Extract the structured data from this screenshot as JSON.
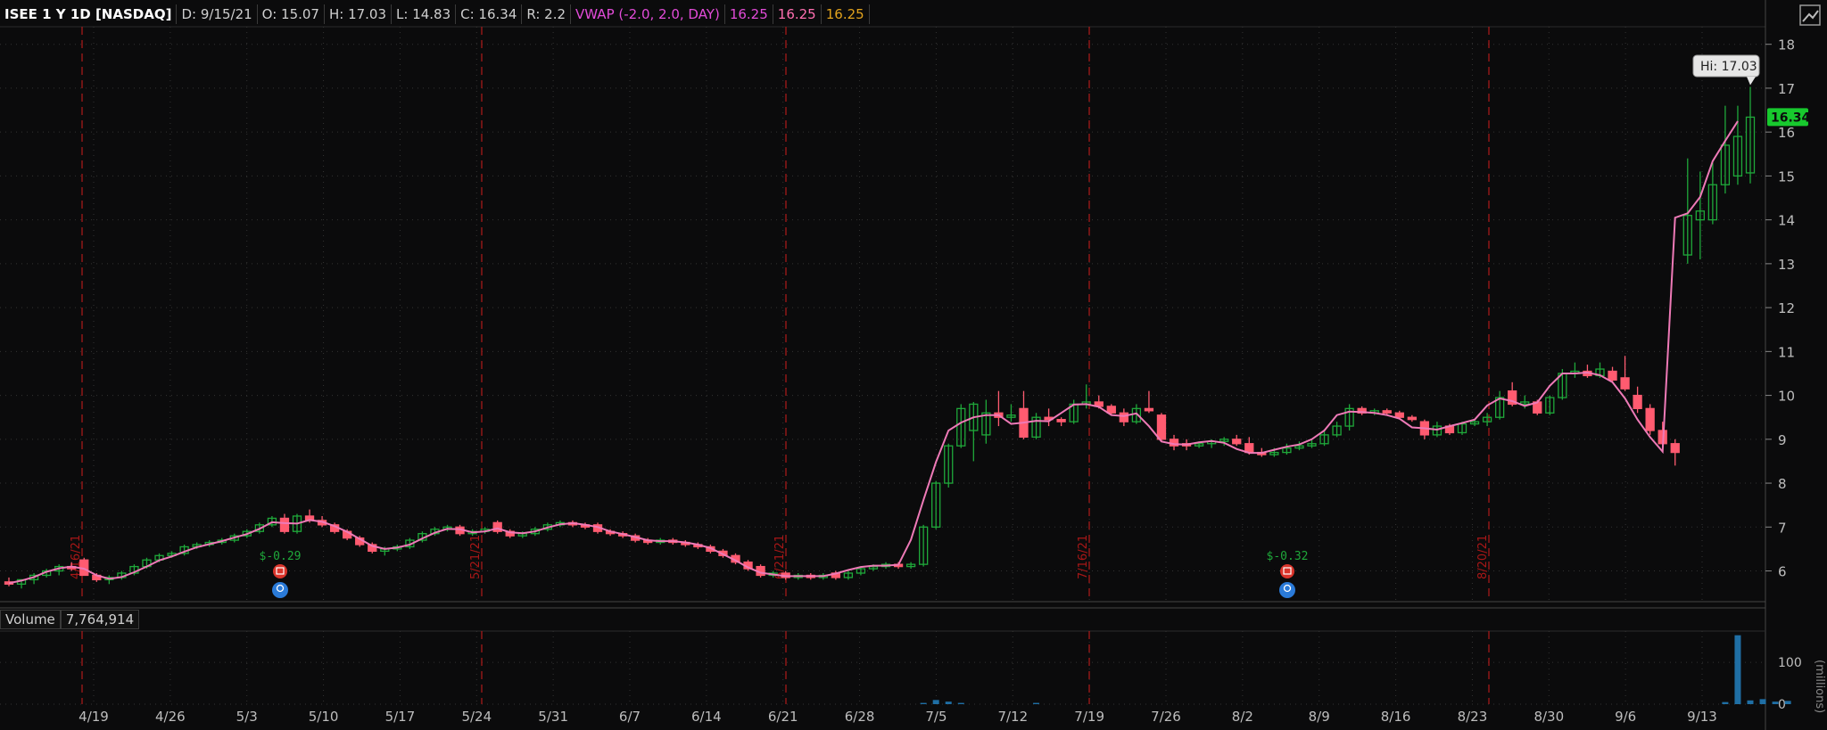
{
  "header": {
    "symbol": "ISEE 1 Y 1D [NASDAQ]",
    "date": "D: 9/15/21",
    "open": "O: 15.07",
    "high": "H: 17.03",
    "low": "L: 14.83",
    "close": "C: 16.34",
    "range": "R: 2.2",
    "vwap_label": "VWAP (-2.0, 2.0, DAY)",
    "vwap_v1": "16.25",
    "vwap_v2": "16.25",
    "vwap_v3": "16.25"
  },
  "volume": {
    "label": "Volume",
    "value": "7,764,914"
  },
  "colors": {
    "up": "#1fa83a",
    "down": "#ff5b70",
    "vwap": "#ee7ab7",
    "grid": "#333",
    "bg": "#0b0b0c",
    "vol": "#1f6fa5",
    "marker": "#b11b1b"
  },
  "chart_data": {
    "type": "candlestick",
    "ylim": [
      5.3,
      18.4
    ],
    "y_ticks": [
      6,
      7,
      8,
      9,
      10,
      11,
      12,
      13,
      14,
      15,
      16,
      17,
      18
    ],
    "x_ticks": [
      "4/19",
      "4/26",
      "5/3",
      "5/10",
      "5/17",
      "5/24",
      "5/31",
      "6/7",
      "6/14",
      "6/21",
      "6/28",
      "7/5",
      "7/12",
      "7/19",
      "7/26",
      "8/2",
      "8/9",
      "8/16",
      "8/23",
      "8/30",
      "9/6",
      "9/13"
    ],
    "last_price": "16.34",
    "high_label": "Hi: 17.03",
    "markers": [
      {
        "date": "4/16/21",
        "label": "4/16/21"
      },
      {
        "date": "5/21/21",
        "label": "5/21/21"
      },
      {
        "date": "6/21/21",
        "label": "6/21/21"
      },
      {
        "date": "7/16/21",
        "label": "7/16/21"
      },
      {
        "date": "8/20/21",
        "label": "8/20/21"
      }
    ],
    "earnings": [
      {
        "date": "5/5",
        "eps": "$-0.29"
      },
      {
        "date": "8/4",
        "eps": "$-0.32"
      }
    ],
    "volume_ylabel": "(millions)",
    "volume_ticks": [
      0,
      100
    ],
    "candles": [
      {
        "o": 5.75,
        "h": 5.85,
        "l": 5.65,
        "c": 5.7
      },
      {
        "o": 5.7,
        "h": 5.8,
        "l": 5.6,
        "c": 5.8
      },
      {
        "o": 5.8,
        "h": 5.95,
        "l": 5.7,
        "c": 5.9
      },
      {
        "o": 5.9,
        "h": 6.05,
        "l": 5.85,
        "c": 6.0
      },
      {
        "o": 6.0,
        "h": 6.15,
        "l": 5.9,
        "c": 6.1
      },
      {
        "o": 6.1,
        "h": 6.2,
        "l": 6.0,
        "c": 6.05
      },
      {
        "o": 6.25,
        "h": 6.3,
        "l": 5.9,
        "c": 5.9
      },
      {
        "o": 5.9,
        "h": 5.95,
        "l": 5.75,
        "c": 5.8
      },
      {
        "o": 5.8,
        "h": 5.9,
        "l": 5.7,
        "c": 5.85
      },
      {
        "o": 5.85,
        "h": 6.0,
        "l": 5.8,
        "c": 5.95
      },
      {
        "o": 5.95,
        "h": 6.15,
        "l": 5.9,
        "c": 6.1
      },
      {
        "o": 6.1,
        "h": 6.3,
        "l": 6.05,
        "c": 6.25
      },
      {
        "o": 6.25,
        "h": 6.4,
        "l": 6.2,
        "c": 6.35
      },
      {
        "o": 6.35,
        "h": 6.45,
        "l": 6.3,
        "c": 6.4
      },
      {
        "o": 6.4,
        "h": 6.6,
        "l": 6.35,
        "c": 6.55
      },
      {
        "o": 6.55,
        "h": 6.65,
        "l": 6.5,
        "c": 6.6
      },
      {
        "o": 6.6,
        "h": 6.7,
        "l": 6.55,
        "c": 6.65
      },
      {
        "o": 6.65,
        "h": 6.75,
        "l": 6.6,
        "c": 6.7
      },
      {
        "o": 6.7,
        "h": 6.85,
        "l": 6.65,
        "c": 6.8
      },
      {
        "o": 6.8,
        "h": 6.95,
        "l": 6.75,
        "c": 6.9
      },
      {
        "o": 6.9,
        "h": 7.1,
        "l": 6.85,
        "c": 7.05
      },
      {
        "o": 7.05,
        "h": 7.25,
        "l": 7.0,
        "c": 7.2
      },
      {
        "o": 7.2,
        "h": 7.3,
        "l": 6.85,
        "c": 6.9
      },
      {
        "o": 6.9,
        "h": 7.3,
        "l": 6.85,
        "c": 7.25
      },
      {
        "o": 7.25,
        "h": 7.4,
        "l": 7.1,
        "c": 7.15
      },
      {
        "o": 7.15,
        "h": 7.25,
        "l": 7.0,
        "c": 7.05
      },
      {
        "o": 7.05,
        "h": 7.1,
        "l": 6.85,
        "c": 6.9
      },
      {
        "o": 6.9,
        "h": 6.95,
        "l": 6.7,
        "c": 6.75
      },
      {
        "o": 6.75,
        "h": 6.8,
        "l": 6.55,
        "c": 6.6
      },
      {
        "o": 6.6,
        "h": 6.65,
        "l": 6.4,
        "c": 6.45
      },
      {
        "o": 6.45,
        "h": 6.55,
        "l": 6.35,
        "c": 6.5
      },
      {
        "o": 6.5,
        "h": 6.6,
        "l": 6.45,
        "c": 6.55
      },
      {
        "o": 6.55,
        "h": 6.75,
        "l": 6.5,
        "c": 6.7
      },
      {
        "o": 6.7,
        "h": 6.9,
        "l": 6.65,
        "c": 6.85
      },
      {
        "o": 6.85,
        "h": 7.0,
        "l": 6.8,
        "c": 6.95
      },
      {
        "o": 6.95,
        "h": 7.05,
        "l": 6.9,
        "c": 7.0
      },
      {
        "o": 7.0,
        "h": 7.05,
        "l": 6.8,
        "c": 6.85
      },
      {
        "o": 6.85,
        "h": 6.95,
        "l": 6.8,
        "c": 6.9
      },
      {
        "o": 6.9,
        "h": 7.0,
        "l": 6.85,
        "c": 6.95
      },
      {
        "o": 7.1,
        "h": 7.15,
        "l": 6.85,
        "c": 6.9
      },
      {
        "o": 6.9,
        "h": 6.95,
        "l": 6.75,
        "c": 6.8
      },
      {
        "o": 6.8,
        "h": 6.9,
        "l": 6.75,
        "c": 6.85
      },
      {
        "o": 6.85,
        "h": 7.0,
        "l": 6.8,
        "c": 6.95
      },
      {
        "o": 6.95,
        "h": 7.1,
        "l": 6.9,
        "c": 7.05
      },
      {
        "o": 7.05,
        "h": 7.15,
        "l": 7.0,
        "c": 7.1
      },
      {
        "o": 7.1,
        "h": 7.15,
        "l": 7.0,
        "c": 7.05
      },
      {
        "o": 7.05,
        "h": 7.1,
        "l": 6.95,
        "c": 7.0
      },
      {
        "o": 7.05,
        "h": 7.1,
        "l": 6.85,
        "c": 6.9
      },
      {
        "o": 6.9,
        "h": 6.95,
        "l": 6.8,
        "c": 6.85
      },
      {
        "o": 6.85,
        "h": 6.9,
        "l": 6.75,
        "c": 6.8
      },
      {
        "o": 6.8,
        "h": 6.85,
        "l": 6.65,
        "c": 6.7
      },
      {
        "o": 6.7,
        "h": 6.75,
        "l": 6.6,
        "c": 6.65
      },
      {
        "o": 6.65,
        "h": 6.75,
        "l": 6.6,
        "c": 6.7
      },
      {
        "o": 6.7,
        "h": 6.75,
        "l": 6.6,
        "c": 6.65
      },
      {
        "o": 6.65,
        "h": 6.7,
        "l": 6.55,
        "c": 6.6
      },
      {
        "o": 6.6,
        "h": 6.65,
        "l": 6.5,
        "c": 6.55
      },
      {
        "o": 6.55,
        "h": 6.6,
        "l": 6.4,
        "c": 6.45
      },
      {
        "o": 6.45,
        "h": 6.5,
        "l": 6.3,
        "c": 6.35
      },
      {
        "o": 6.35,
        "h": 6.4,
        "l": 6.15,
        "c": 6.2
      },
      {
        "o": 6.2,
        "h": 6.25,
        "l": 6.0,
        "c": 6.05
      },
      {
        "o": 6.1,
        "h": 6.15,
        "l": 5.85,
        "c": 5.9
      },
      {
        "o": 5.9,
        "h": 6.0,
        "l": 5.85,
        "c": 5.95
      },
      {
        "o": 5.95,
        "h": 6.0,
        "l": 5.8,
        "c": 5.85
      },
      {
        "o": 5.85,
        "h": 5.95,
        "l": 5.8,
        "c": 5.9
      },
      {
        "o": 5.9,
        "h": 5.95,
        "l": 5.8,
        "c": 5.85
      },
      {
        "o": 5.85,
        "h": 5.95,
        "l": 5.8,
        "c": 5.9
      },
      {
        "o": 5.95,
        "h": 6.0,
        "l": 5.8,
        "c": 5.85
      },
      {
        "o": 5.85,
        "h": 6.0,
        "l": 5.8,
        "c": 5.95
      },
      {
        "o": 5.95,
        "h": 6.1,
        "l": 5.9,
        "c": 6.05
      },
      {
        "o": 6.05,
        "h": 6.15,
        "l": 6.0,
        "c": 6.1
      },
      {
        "o": 6.1,
        "h": 6.2,
        "l": 6.05,
        "c": 6.15
      },
      {
        "o": 6.15,
        "h": 6.2,
        "l": 6.05,
        "c": 6.1
      },
      {
        "o": 6.1,
        "h": 6.2,
        "l": 6.05,
        "c": 6.15
      },
      {
        "o": 6.15,
        "h": 7.05,
        "l": 6.1,
        "c": 7.0
      },
      {
        "o": 7.0,
        "h": 8.05,
        "l": 6.95,
        "c": 8.0
      },
      {
        "o": 8.0,
        "h": 8.9,
        "l": 7.9,
        "c": 8.85
      },
      {
        "o": 8.85,
        "h": 9.8,
        "l": 8.8,
        "c": 9.7
      },
      {
        "o": 9.2,
        "h": 9.85,
        "l": 8.5,
        "c": 9.8
      },
      {
        "o": 9.1,
        "h": 9.9,
        "l": 8.9,
        "c": 9.6
      },
      {
        "o": 9.6,
        "h": 10.1,
        "l": 9.3,
        "c": 9.5
      },
      {
        "o": 9.5,
        "h": 9.8,
        "l": 9.4,
        "c": 9.55
      },
      {
        "o": 9.7,
        "h": 10.1,
        "l": 9.0,
        "c": 9.05
      },
      {
        "o": 9.05,
        "h": 9.6,
        "l": 9.0,
        "c": 9.5
      },
      {
        "o": 9.5,
        "h": 9.7,
        "l": 9.3,
        "c": 9.45
      },
      {
        "o": 9.45,
        "h": 9.5,
        "l": 9.3,
        "c": 9.4
      },
      {
        "o": 9.4,
        "h": 9.9,
        "l": 9.35,
        "c": 9.8
      },
      {
        "o": 9.8,
        "h": 10.25,
        "l": 9.7,
        "c": 9.85
      },
      {
        "o": 9.85,
        "h": 10.0,
        "l": 9.7,
        "c": 9.75
      },
      {
        "o": 9.75,
        "h": 9.8,
        "l": 9.55,
        "c": 9.6
      },
      {
        "o": 9.6,
        "h": 9.7,
        "l": 9.3,
        "c": 9.4
      },
      {
        "o": 9.4,
        "h": 9.8,
        "l": 9.35,
        "c": 9.7
      },
      {
        "o": 9.7,
        "h": 10.1,
        "l": 9.6,
        "c": 9.65
      },
      {
        "o": 9.55,
        "h": 9.6,
        "l": 8.95,
        "c": 9.0
      },
      {
        "o": 9.0,
        "h": 9.1,
        "l": 8.75,
        "c": 8.85
      },
      {
        "o": 8.9,
        "h": 9.0,
        "l": 8.75,
        "c": 8.85
      },
      {
        "o": 8.85,
        "h": 8.95,
        "l": 8.8,
        "c": 8.9
      },
      {
        "o": 8.9,
        "h": 9.0,
        "l": 8.8,
        "c": 8.95
      },
      {
        "o": 8.95,
        "h": 9.05,
        "l": 8.85,
        "c": 9.0
      },
      {
        "o": 9.0,
        "h": 9.1,
        "l": 8.85,
        "c": 8.9
      },
      {
        "o": 8.9,
        "h": 9.05,
        "l": 8.65,
        "c": 8.7
      },
      {
        "o": 8.7,
        "h": 8.8,
        "l": 8.6,
        "c": 8.65
      },
      {
        "o": 8.65,
        "h": 8.8,
        "l": 8.6,
        "c": 8.7
      },
      {
        "o": 8.7,
        "h": 8.9,
        "l": 8.65,
        "c": 8.8
      },
      {
        "o": 8.8,
        "h": 8.95,
        "l": 8.75,
        "c": 8.85
      },
      {
        "o": 8.85,
        "h": 9.0,
        "l": 8.8,
        "c": 8.9
      },
      {
        "o": 8.9,
        "h": 9.2,
        "l": 8.85,
        "c": 9.1
      },
      {
        "o": 9.1,
        "h": 9.4,
        "l": 9.05,
        "c": 9.3
      },
      {
        "o": 9.3,
        "h": 9.8,
        "l": 9.2,
        "c": 9.7
      },
      {
        "o": 9.7,
        "h": 9.75,
        "l": 9.55,
        "c": 9.6
      },
      {
        "o": 9.6,
        "h": 9.7,
        "l": 9.55,
        "c": 9.65
      },
      {
        "o": 9.65,
        "h": 9.7,
        "l": 9.55,
        "c": 9.6
      },
      {
        "o": 9.6,
        "h": 9.65,
        "l": 9.45,
        "c": 9.5
      },
      {
        "o": 9.5,
        "h": 9.55,
        "l": 9.4,
        "c": 9.45
      },
      {
        "o": 9.4,
        "h": 9.45,
        "l": 9.0,
        "c": 9.1
      },
      {
        "o": 9.1,
        "h": 9.4,
        "l": 9.05,
        "c": 9.3
      },
      {
        "o": 9.3,
        "h": 9.35,
        "l": 9.1,
        "c": 9.15
      },
      {
        "o": 9.15,
        "h": 9.4,
        "l": 9.1,
        "c": 9.35
      },
      {
        "o": 9.35,
        "h": 9.45,
        "l": 9.3,
        "c": 9.4
      },
      {
        "o": 9.4,
        "h": 9.6,
        "l": 9.3,
        "c": 9.5
      },
      {
        "o": 9.5,
        "h": 10.1,
        "l": 9.45,
        "c": 9.95
      },
      {
        "o": 10.1,
        "h": 10.3,
        "l": 9.75,
        "c": 9.8
      },
      {
        "o": 9.8,
        "h": 10.0,
        "l": 9.7,
        "c": 9.85
      },
      {
        "o": 9.85,
        "h": 9.9,
        "l": 9.55,
        "c": 9.6
      },
      {
        "o": 9.6,
        "h": 10.0,
        "l": 9.55,
        "c": 9.95
      },
      {
        "o": 9.95,
        "h": 10.6,
        "l": 9.9,
        "c": 10.5
      },
      {
        "o": 10.5,
        "h": 10.75,
        "l": 10.4,
        "c": 10.55
      },
      {
        "o": 10.55,
        "h": 10.7,
        "l": 10.4,
        "c": 10.45
      },
      {
        "o": 10.45,
        "h": 10.75,
        "l": 10.4,
        "c": 10.6
      },
      {
        "o": 10.55,
        "h": 10.65,
        "l": 10.3,
        "c": 10.35
      },
      {
        "o": 10.4,
        "h": 10.9,
        "l": 10.1,
        "c": 10.15
      },
      {
        "o": 10.0,
        "h": 10.2,
        "l": 9.6,
        "c": 9.7
      },
      {
        "o": 9.7,
        "h": 9.8,
        "l": 9.1,
        "c": 9.2
      },
      {
        "o": 9.2,
        "h": 9.4,
        "l": 8.7,
        "c": 8.9
      },
      {
        "o": 8.9,
        "h": 9.0,
        "l": 8.4,
        "c": 8.7
      },
      {
        "o": 13.2,
        "h": 15.4,
        "l": 13.0,
        "c": 14.1
      },
      {
        "o": 14.0,
        "h": 15.1,
        "l": 13.1,
        "c": 14.2
      },
      {
        "o": 14.0,
        "h": 15.3,
        "l": 13.9,
        "c": 14.8
      },
      {
        "o": 14.8,
        "h": 16.6,
        "l": 14.6,
        "c": 15.7
      },
      {
        "o": 15.0,
        "h": 16.6,
        "l": 14.8,
        "c": 15.9
      },
      {
        "o": 15.07,
        "h": 17.03,
        "l": 14.83,
        "c": 16.34
      }
    ],
    "vwap": [
      5.72,
      5.78,
      5.86,
      5.98,
      6.06,
      6.1,
      6.05,
      5.9,
      5.82,
      5.86,
      5.97,
      6.1,
      6.24,
      6.33,
      6.44,
      6.54,
      6.61,
      6.68,
      6.76,
      6.84,
      6.96,
      7.11,
      7.09,
      7.08,
      7.16,
      7.12,
      7.02,
      6.89,
      6.73,
      6.57,
      6.5,
      6.53,
      6.6,
      6.74,
      6.87,
      6.96,
      6.95,
      6.88,
      6.9,
      6.97,
      6.88,
      6.86,
      6.9,
      6.99,
      7.06,
      7.09,
      7.05,
      7.0,
      6.9,
      6.84,
      6.77,
      6.7,
      6.68,
      6.68,
      6.65,
      6.6,
      6.52,
      6.38,
      6.24,
      6.08,
      5.96,
      5.92,
      5.88,
      5.88,
      5.88,
      5.88,
      5.94,
      6.02,
      6.09,
      6.12,
      6.12,
      6.14,
      6.71,
      7.62,
      8.48,
      9.2,
      9.38,
      9.5,
      9.55,
      9.55,
      9.35,
      9.38,
      9.42,
      9.41,
      9.6,
      9.79,
      9.8,
      9.74,
      9.55,
      9.53,
      9.59,
      9.3,
      8.95,
      8.89,
      8.88,
      8.93,
      8.96,
      8.92,
      8.78,
      8.69,
      8.69,
      8.76,
      8.83,
      8.88,
      9.0,
      9.2,
      9.55,
      9.63,
      9.62,
      9.6,
      9.55,
      9.47,
      9.27,
      9.25,
      9.22,
      9.3,
      9.37,
      9.45,
      9.77,
      9.93,
      9.87,
      9.76,
      9.84,
      10.22,
      10.5,
      10.5,
      10.52,
      10.46,
      10.3,
      9.93,
      9.45,
      9.05,
      8.72,
      14.05,
      14.15,
      14.52,
      15.34,
      15.8,
      16.25
    ],
    "volume_bar_values": [
      0,
      0,
      0,
      0,
      0,
      0,
      0,
      0,
      0,
      0,
      0,
      0,
      0,
      0,
      0,
      0,
      0,
      0,
      0,
      0,
      0,
      0,
      0,
      0,
      0,
      0,
      0,
      0,
      0,
      0,
      0,
      0,
      0,
      0,
      0,
      0,
      0,
      0,
      0,
      0,
      0,
      0,
      0,
      0,
      0,
      0,
      0,
      0,
      0,
      0,
      0,
      0,
      0,
      0,
      0,
      0,
      0,
      0,
      0,
      0,
      0,
      0,
      0,
      0,
      0,
      0,
      0,
      0,
      0,
      0,
      0,
      0,
      0,
      3,
      10,
      6,
      3,
      0,
      0,
      0,
      0,
      0,
      3,
      0,
      0,
      0,
      0,
      0,
      0,
      0,
      0,
      0,
      0,
      0,
      0,
      0,
      0,
      0,
      0,
      0,
      0,
      0,
      0,
      0,
      0,
      0,
      0,
      0,
      0,
      0,
      0,
      0,
      0,
      0,
      0,
      0,
      0,
      0,
      0,
      0,
      0,
      0,
      0,
      0,
      0,
      0,
      0,
      0,
      0,
      0,
      0,
      0,
      0,
      0,
      0,
      0,
      0,
      5,
      165,
      9,
      12,
      6,
      7.76
    ]
  }
}
